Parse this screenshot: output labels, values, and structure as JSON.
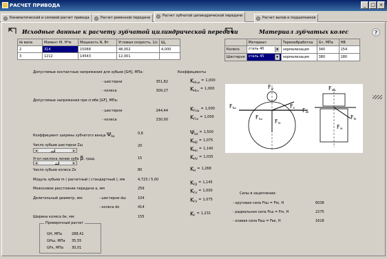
{
  "window": {
    "title": "РАСЧЕТ ПРИВОДА",
    "buttons": {
      "min": "_",
      "max": "□",
      "close": "×"
    }
  },
  "tabs": [
    {
      "label": "Кинематический и силовой расчет привода"
    },
    {
      "label": "Расчет ременной передачи"
    },
    {
      "label": "Расчет зубчатой цилиндрической передачи"
    },
    {
      "label": "Расчет валов и подшипников"
    }
  ],
  "left_heading": "Исходные данные к расчету зубчатой цилиндрической передачи",
  "shaft_table": {
    "headers": [
      "№ вала",
      "Момент М, Н*м",
      "Мощность N, Вт",
      "Угловая скорость, 1/с",
      "Щ,"
    ],
    "rows": [
      [
        "2",
        "314",
        "15068",
        "48,002",
        "4,000"
      ],
      [
        "3",
        "1212",
        "14543",
        "12,001",
        ""
      ]
    ]
  },
  "right_heading": "Материал зубчатых колес",
  "material_table": {
    "headers": [
      "",
      "Материал",
      "Термообработка",
      "Gт, МПа",
      "HB"
    ],
    "rows": [
      {
        "name": "Колесо",
        "material": "сталь 40",
        "treatment": "нормализация",
        "gt": "340",
        "hb": "154"
      },
      {
        "name": "Шестерня",
        "material": "сталь 45",
        "treatment": "нормализация",
        "gt": "380",
        "hb": "180"
      }
    ]
  },
  "help_label": "?",
  "coeffs_title": "Коэффициенты",
  "contact": {
    "title": "Допустимые контактные напряжения для зубьев [GH], МПа:",
    "pinion_label": "- шестерни",
    "pinion_value": "351,82",
    "wheel_label": "- колеса",
    "wheel_value": "309,27"
  },
  "bending": {
    "title": "Допустимые напряжения при сгибе [GF], МПа:",
    "pinion_label": "- шестерни",
    "pinion_value": "244,44",
    "wheel_label": "- колеса",
    "wheel_value": "230,00"
  },
  "params": {
    "psi_label": "Коэффициент ширины зубчатого венца",
    "psi_sym": "Ψ",
    "psi_sub": "ba",
    "psi_value": "0,6",
    "z_pinion_label": "Число зубьев шестерни Zш",
    "z_pinion_value": "20",
    "beta_label": "Угол наклона линии зуба",
    "beta_sym": "β",
    "beta_unit": ", град.",
    "beta_value": "15",
    "z_wheel_label": "Число зубьев колеса Zк",
    "z_wheel_value": "80",
    "module_label": "Модуль зубьев m ( расчетный / стандартный ), мм",
    "module_value": "4,723 / 5,00",
    "center_label": "Межосевое расстояние передачи a, мм",
    "center_value": "259",
    "diam_label": "Делительный диаметр, мм:",
    "diam_pinion_label": "- шестерни dш",
    "diam_pinion_value": "104",
    "diam_wheel_label": "- колеса dк",
    "diam_wheel_value": "414",
    "width_label": "Ширина колеса bк, мм",
    "width_value": "155"
  },
  "check": {
    "title": "Проверочный расчет",
    "rows": [
      {
        "label": "GH, МПа",
        "value": "288,41"
      },
      {
        "label": "GHш, МПа",
        "value": "35,55"
      },
      {
        "label": "GFк, МПа",
        "value": "30,01"
      }
    ]
  },
  "coefficients": [
    {
      "sub": "HLш",
      "value": "1,000"
    },
    {
      "sub": "HLк",
      "value": "1,000"
    },
    {
      "sub": "FLш",
      "value": "1,000"
    },
    {
      "sub": "FLк",
      "value": "1,000"
    },
    {
      "sub": "bd",
      "value": "1,500",
      "greek": true
    },
    {
      "sub": "Hβ",
      "value": "1,075"
    },
    {
      "sub": "Hα",
      "value": "1,140"
    },
    {
      "sub": "HV",
      "value": "1,035"
    },
    {
      "sub": "H",
      "value": "1,268"
    },
    {
      "sub": "Fβ",
      "value": "1,145"
    },
    {
      "sub": "Fα",
      "value": "1,000"
    },
    {
      "sub": "FV",
      "value": "1,075"
    },
    {
      "sub": "F",
      "value": "1,231"
    }
  ],
  "coef_prefix": "K",
  "psi_prefix": "Ψ",
  "eq_sign": "=",
  "diagram_labels": {
    "fsh": "F",
    "fsh_sub": "ш",
    "ftsh": "F",
    "ftsh_sub": "tш",
    "ftk": "F",
    "ftk_sub": "tк",
    "fk": "F",
    "fk_sub": "к",
    "frsh": "F",
    "frsh_sub": "rш",
    "frk": "F",
    "frk_sub": "rк",
    "fash": "F",
    "fash_sub": "aш",
    "fak": "F",
    "fak_sub": "aк",
    "fr": "F",
    "fr_sub": "rк"
  },
  "forces": {
    "title": "Силы в зацеплении:",
    "rows": [
      {
        "label": "- круговая сила Ftш = Ftк, Н",
        "value": "6038"
      },
      {
        "label": "- радиальная сила Frш = Frк, Н",
        "value": "2275"
      },
      {
        "label": "- осевая сила Faш = Faк, Н",
        "value": "1618"
      }
    ]
  }
}
